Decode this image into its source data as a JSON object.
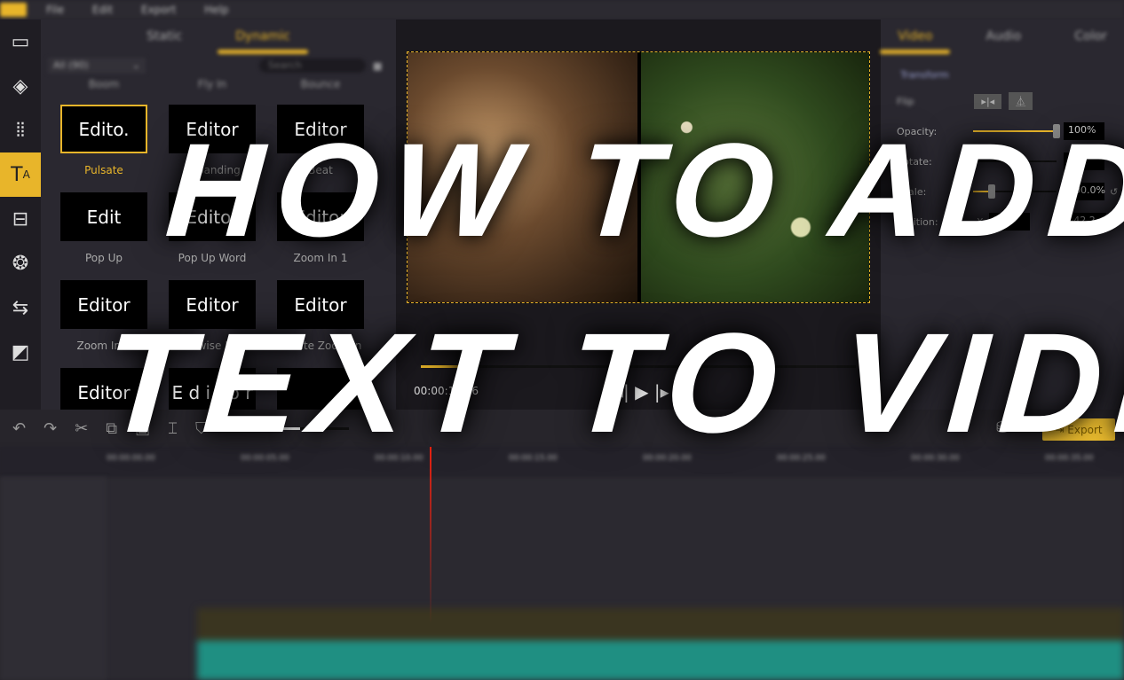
{
  "titlebar": {
    "menu": [
      "File",
      "Edit",
      "Export",
      "Help"
    ]
  },
  "sidebar": {
    "icons": [
      "folder-icon",
      "layers-icon",
      "audio-wave-icon",
      "text-icon",
      "template-icon",
      "filters-icon",
      "transitions-icon",
      "sticker-icon"
    ]
  },
  "library": {
    "tabs": [
      "Static",
      "Dynamic"
    ],
    "active_tab": "Dynamic",
    "filter": "All (90)",
    "search_placeholder": "Search",
    "headers": [
      "Boom",
      "Fly In",
      "Bounce"
    ],
    "items": [
      {
        "thumb": "Edito.",
        "label": "Pulsate",
        "selected": true
      },
      {
        "thumb": "Editor",
        "label": "Expanding"
      },
      {
        "thumb": "Editor",
        "label": "Beat"
      },
      {
        "thumb": "Edit",
        "label": "Pop Up"
      },
      {
        "thumb": "Editor",
        "label": "Pop Up Word"
      },
      {
        "thumb": "Editor",
        "label": "Zoom In 1"
      },
      {
        "thumb": "Editor",
        "label": "Zoom In 2"
      },
      {
        "thumb": "Editor",
        "label": "Clockwise Rotat..."
      },
      {
        "thumb": "Editor",
        "label": "Rotate Zoom In"
      },
      {
        "thumb": "Editor",
        "label": ""
      },
      {
        "thumb": "E d i t o r",
        "label": ""
      },
      {
        "thumb": "",
        "label": ""
      }
    ]
  },
  "player": {
    "time": "00:00:12.16",
    "progress_pct": 9
  },
  "properties": {
    "tabs": [
      "Video",
      "Audio",
      "Color"
    ],
    "active_tab": "Video",
    "section": "Transform",
    "flip_label": "Flip",
    "opacity": {
      "label": "Opacity:",
      "value": "100%",
      "pct": 100
    },
    "rotate": {
      "label": "Rotate:",
      "value": "0°",
      "pct": 0
    },
    "scale": {
      "label": "Scale:",
      "value": "100.0%",
      "pct": 22
    },
    "position": {
      "label": "Position:",
      "x_label": "X",
      "x": "3.6",
      "y_label": "Y",
      "y": "-42.2"
    }
  },
  "toolbar": {
    "export_label": "Export"
  },
  "timeline": {
    "ticks": [
      "00:00:00.00",
      "00:00:05.00",
      "00:00:10.00",
      "00:00:15.00",
      "00:00:20.00",
      "00:00:25.00",
      "00:00:30.00",
      "00:00:35.00"
    ]
  },
  "overlay": {
    "line1": "HOW TO ADD",
    "line2": "TEXT TO VIDEO"
  },
  "colors": {
    "accent": "#e8b52a",
    "playhead": "#e21111"
  }
}
